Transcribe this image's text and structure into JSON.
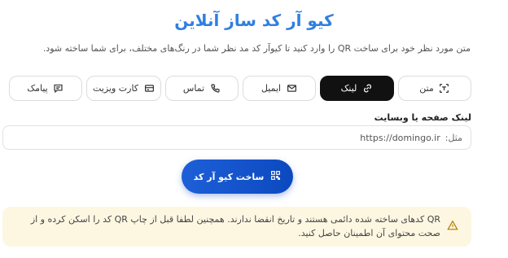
{
  "header": {
    "title": "کیو آر کد ساز آنلاین",
    "subtitle": "متن مورد نظر خود برای ساخت QR را وارد کنید تا کیوآر کد مد نظر شما در رنگ‌های مختلف، برای شما ساخته شود."
  },
  "tabs": [
    {
      "label": "متن",
      "icon": "scan-text-icon"
    },
    {
      "label": "لینک",
      "icon": "link-icon",
      "active": true
    },
    {
      "label": "ایمیل",
      "icon": "mail-icon"
    },
    {
      "label": "تماس",
      "icon": "phone-icon"
    },
    {
      "label": "کارت ویزیت",
      "icon": "card-icon"
    },
    {
      "label": "پیامک",
      "icon": "message-icon"
    }
  ],
  "form": {
    "label": "لینک صفحه یا وبسایت",
    "prefix": "مثل:",
    "placeholder": "https://domingo.ir"
  },
  "submit": {
    "label": "ساخت کیو آر کد",
    "icon": "qr-icon"
  },
  "notice": {
    "text": "QR کدهای ساخته شده دائمی هستند و تاریخ انقضا ندارند. همچنین لطفا قبل از چاپ QR کد را اسکن کرده و از صحت محتوای آن اطمینان حاصل کنید.",
    "icon": "warning-icon",
    "color": "#fdf7e2"
  },
  "colors": {
    "accent": "#2f7fe0",
    "button": "#1456d0",
    "active_tab": "#111111"
  }
}
